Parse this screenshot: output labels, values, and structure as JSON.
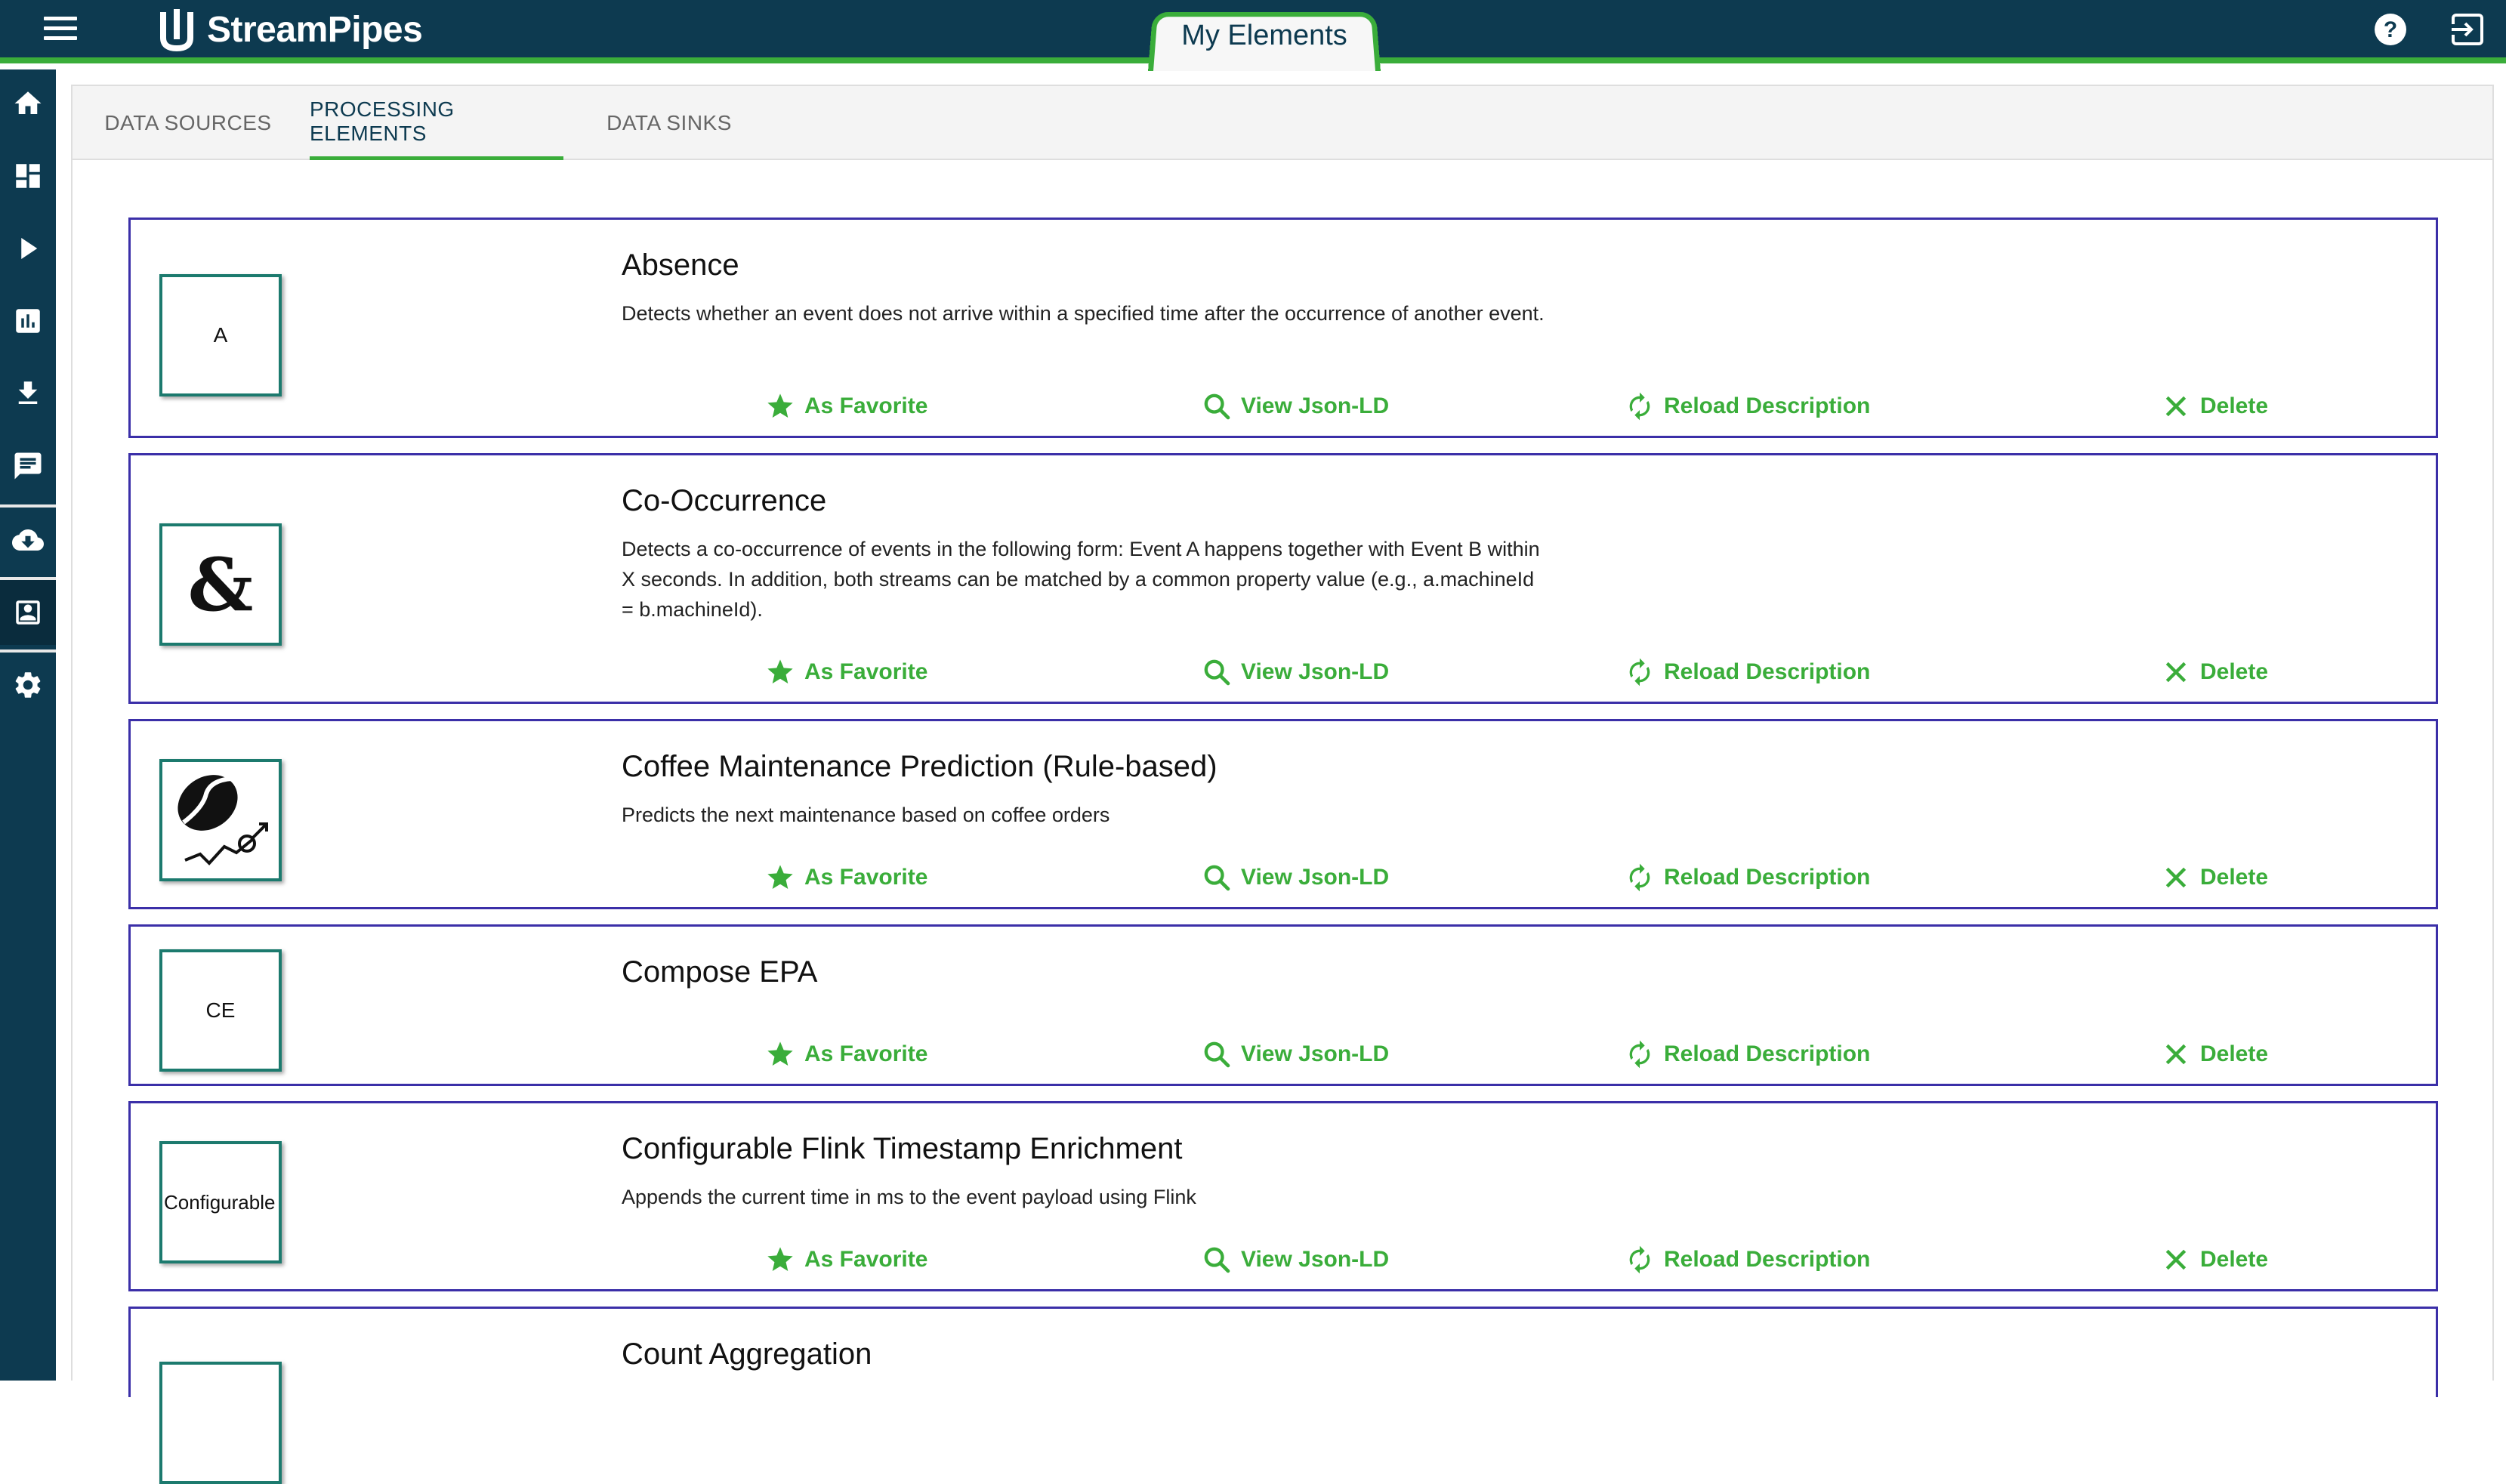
{
  "app": {
    "name": "StreamPipes",
    "active_tab": "My Elements"
  },
  "header": {
    "menu_icon": "menu-icon",
    "help_icon": "help-icon",
    "logout_icon": "logout-icon"
  },
  "sidebar": {
    "items": [
      {
        "icon": "home-icon"
      },
      {
        "icon": "dashboard-icon"
      },
      {
        "icon": "play-icon"
      },
      {
        "icon": "bar-chart-icon"
      },
      {
        "icon": "download-icon"
      },
      {
        "icon": "chat-icon"
      },
      {
        "icon": "cloud-download-icon"
      },
      {
        "icon": "contact-card-icon"
      },
      {
        "icon": "settings-icon"
      }
    ]
  },
  "tabs": [
    {
      "label": "DATA SOURCES"
    },
    {
      "label": "PROCESSING ELEMENTS"
    },
    {
      "label": "DATA SINKS"
    }
  ],
  "actions": {
    "favorite": "As Favorite",
    "view_json": "View Json-LD",
    "reload": "Reload Description",
    "delete": "Delete"
  },
  "elements": [
    {
      "title": "Absence",
      "icon_text": "A",
      "description": "Detects whether an event does not arrive within a specified time after the occurrence of another event."
    },
    {
      "title": "Co-Occurrence",
      "icon_text": "&",
      "description": "Detects a co-occurrence of events in the following form: Event A happens together with Event B within X seconds. In addition, both streams can be matched by a common property value (e.g., a.machineId = b.machineId)."
    },
    {
      "title": "Coffee Maintenance Prediction (Rule-based)",
      "icon_text": "",
      "description": "Predicts the next maintenance based on coffee orders"
    },
    {
      "title": "Compose EPA",
      "icon_text": "CE",
      "description": ""
    },
    {
      "title": "Configurable Flink Timestamp Enrichment",
      "icon_text": "Configurable",
      "description": "Appends the current time in ms to the event payload using Flink"
    },
    {
      "title": "Count Aggregation",
      "icon_text": "",
      "description": ""
    }
  ],
  "colors": {
    "header": "#0d3a50",
    "accent": "#3aad3a",
    "card_border": "#3b2fa8",
    "icon_border": "#1c7a6e"
  }
}
